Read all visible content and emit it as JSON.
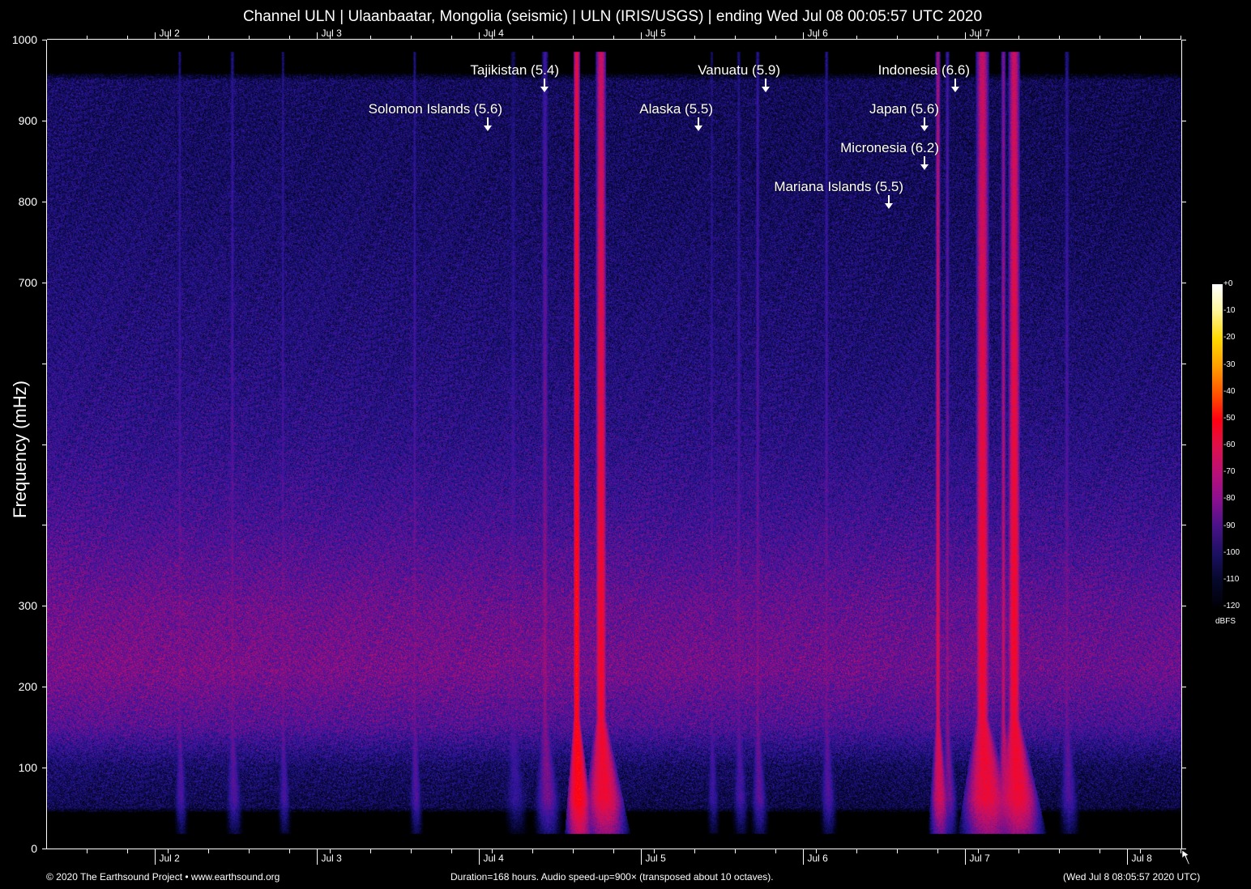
{
  "chart_data": {
    "type": "heatmap",
    "title": "Channel ULN | Ulaanbaatar, Mongolia (seismic) | ULN (IRIS/USGS) | ending Wed Jul 08 00:05:57 UTC 2020",
    "ylabel": "Frequency (mHz)",
    "xlabel": "",
    "ylim": [
      0,
      1000
    ],
    "xlim_hours": [
      0,
      168
    ],
    "y_ticks": [
      {
        "value": 0,
        "label": "0"
      },
      {
        "value": 100,
        "label": "100"
      },
      {
        "value": 200,
        "label": "200"
      },
      {
        "value": 300,
        "label": "300"
      },
      {
        "value": 400,
        "label": ""
      },
      {
        "value": 500,
        "label": ""
      },
      {
        "value": 600,
        "label": ""
      },
      {
        "value": 700,
        "label": "700"
      },
      {
        "value": 800,
        "label": "800"
      },
      {
        "value": 900,
        "label": "900"
      },
      {
        "value": 1000,
        "label": "1000"
      }
    ],
    "x_ticks_top": [
      {
        "hours": 15.9,
        "label": "Jul 2"
      },
      {
        "hours": 39.9,
        "label": "Jul 3"
      },
      {
        "hours": 63.9,
        "label": "Jul 4"
      },
      {
        "hours": 87.9,
        "label": "Jul 5"
      },
      {
        "hours": 111.9,
        "label": "Jul 6"
      },
      {
        "hours": 135.9,
        "label": "Jul 7"
      }
    ],
    "x_ticks_bottom": [
      {
        "hours": 15.9,
        "label": "Jul 2"
      },
      {
        "hours": 39.9,
        "label": "Jul 3"
      },
      {
        "hours": 63.9,
        "label": "Jul 4"
      },
      {
        "hours": 87.9,
        "label": "Jul 5"
      },
      {
        "hours": 111.9,
        "label": "Jul 6"
      },
      {
        "hours": 135.9,
        "label": "Jul 7"
      },
      {
        "hours": 159.9,
        "label": "Jul 8"
      }
    ],
    "minor_tick_hours": 6,
    "colorbar": {
      "unit": "dBFS",
      "range": [
        -120,
        0
      ],
      "ticks": [
        "+0",
        "-10",
        "-20",
        "-30",
        "-40",
        "-50",
        "-60",
        "-70",
        "-80",
        "-90",
        "-100",
        "-110",
        "-120"
      ]
    },
    "background_profile": {
      "freq_mhz": [
        0,
        40,
        50,
        100,
        150,
        220,
        300,
        400,
        500,
        600,
        700,
        800,
        900,
        950,
        965,
        1000
      ],
      "dbfs": [
        -125,
        -125,
        -104,
        -100,
        -86,
        -80,
        -82,
        -88,
        -93,
        -96,
        -98,
        -100,
        -101,
        -101,
        -125,
        -125
      ]
    },
    "events": [
      {
        "hours": 78.4,
        "peak_dbfs": -48,
        "width_hours": 0.12
      },
      {
        "hours": 82.0,
        "peak_dbfs": -55,
        "width_hours": 0.2
      },
      {
        "hours": 73.7,
        "peak_dbfs": -78,
        "width_hours": 0.15
      },
      {
        "hours": 131.9,
        "peak_dbfs": -62,
        "width_hours": 0.1
      },
      {
        "hours": 133.3,
        "peak_dbfs": -78,
        "width_hours": 0.1
      },
      {
        "hours": 138.5,
        "peak_dbfs": -56,
        "width_hours": 0.25
      },
      {
        "hours": 141.6,
        "peak_dbfs": -68,
        "width_hours": 0.1
      },
      {
        "hours": 143.2,
        "peak_dbfs": -55,
        "width_hours": 0.22
      },
      {
        "hours": 19.6,
        "peak_dbfs": -85,
        "width_hours": 0.08
      },
      {
        "hours": 27.4,
        "peak_dbfs": -84,
        "width_hours": 0.1
      },
      {
        "hours": 34.9,
        "peak_dbfs": -86,
        "width_hours": 0.08
      },
      {
        "hours": 54.4,
        "peak_dbfs": -84,
        "width_hours": 0.08
      },
      {
        "hours": 98.4,
        "peak_dbfs": -88,
        "width_hours": 0.08
      },
      {
        "hours": 102.4,
        "peak_dbfs": -86,
        "width_hours": 0.1
      },
      {
        "hours": 105.2,
        "peak_dbfs": -82,
        "width_hours": 0.1
      },
      {
        "hours": 115.4,
        "peak_dbfs": -84,
        "width_hours": 0.1
      },
      {
        "hours": 151.0,
        "peak_dbfs": -84,
        "width_hours": 0.12
      },
      {
        "hours": 69.0,
        "peak_dbfs": -90,
        "width_hours": 0.15
      }
    ],
    "annotations": [
      {
        "label": "Tajikistan (5.4)",
        "hours": 73.7
      },
      {
        "label": "Solomon Islands (5.6)",
        "hours": 65.3
      },
      {
        "label": "Vanuatu (5.9)",
        "hours": 106.4
      },
      {
        "label": "Alaska (5.5)",
        "hours": 96.5
      },
      {
        "label": "Indonesia (6.6)",
        "hours": 134.5
      },
      {
        "label": "Japan (5.6)",
        "hours": 130.0
      },
      {
        "label": "Micronesia (6.2)",
        "hours": 130.0
      },
      {
        "label": "Mariana Islands (5.5)",
        "hours": 124.7
      }
    ]
  },
  "footer": {
    "copyright": "© 2020 The Earthsound Project • www.earthsound.org",
    "info": "Duration=168 hours. Audio speed-up=900× (transposed about 10 octaves).",
    "timestamp": "(Wed Jul  8 08:05:57 2020 UTC)"
  },
  "icons": {
    "cursor": "mouse-pointer-icon"
  }
}
